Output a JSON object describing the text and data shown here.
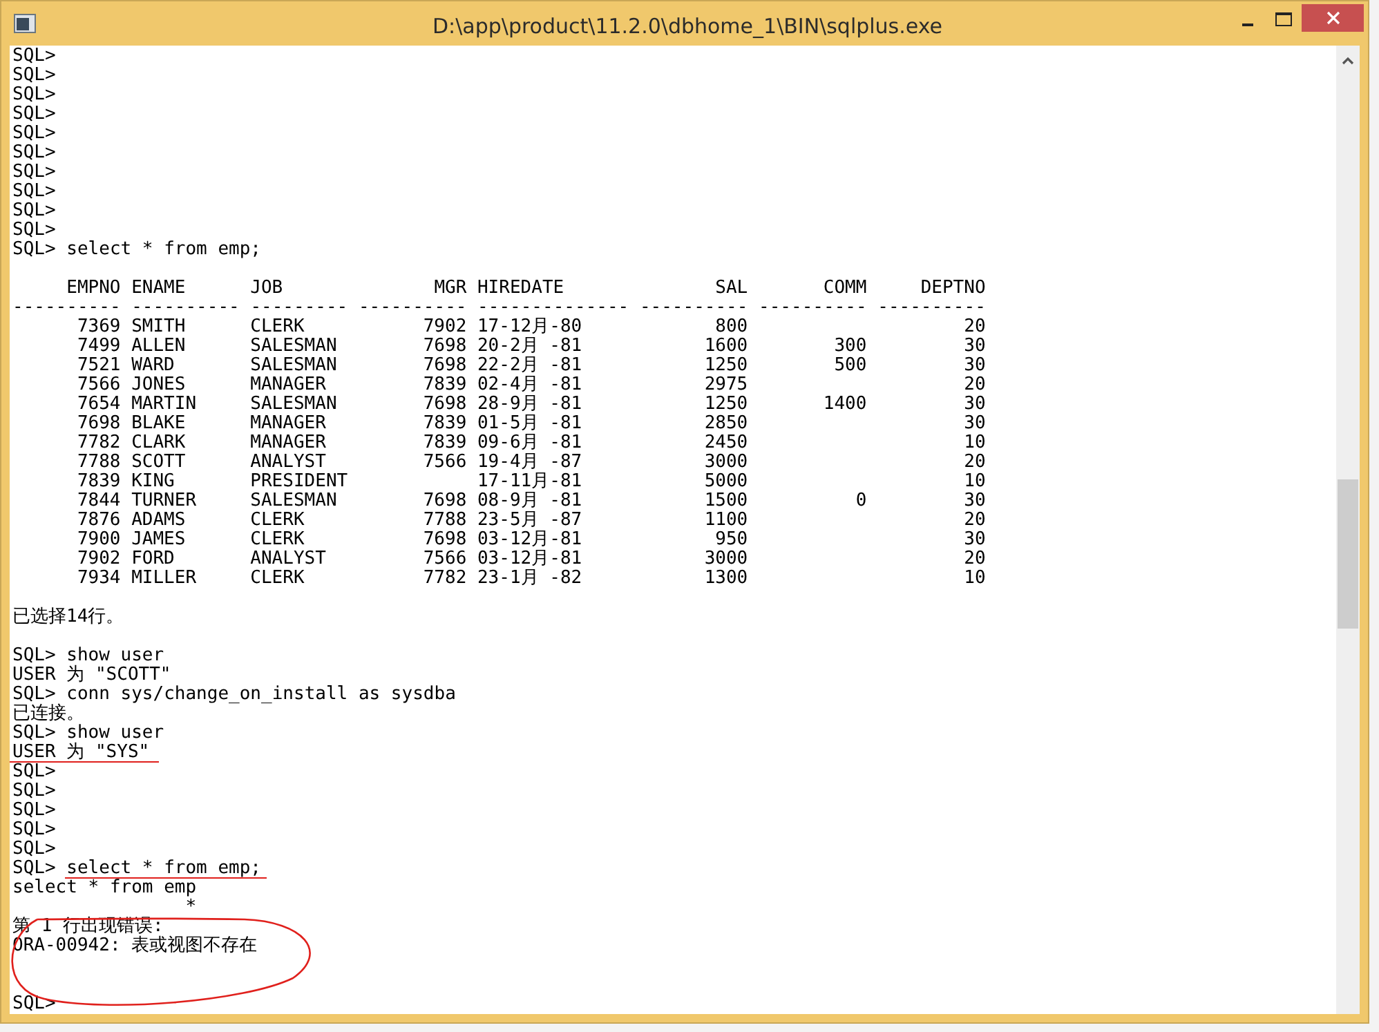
{
  "window": {
    "title": "D:\\app\\product\\11.2.0\\dbhome_1\\BIN\\sqlplus.exe"
  },
  "console": [
    {
      "kind": "line",
      "text": "SQL>"
    },
    {
      "kind": "line",
      "text": "SQL>"
    },
    {
      "kind": "line",
      "text": "SQL>"
    },
    {
      "kind": "line",
      "text": "SQL>"
    },
    {
      "kind": "line",
      "text": "SQL>"
    },
    {
      "kind": "line",
      "text": "SQL>"
    },
    {
      "kind": "line",
      "text": "SQL>"
    },
    {
      "kind": "line",
      "text": "SQL>"
    },
    {
      "kind": "line",
      "text": "SQL>"
    },
    {
      "kind": "line",
      "text": "SQL>"
    },
    {
      "kind": "line",
      "text": "SQL> select * from emp;"
    },
    {
      "kind": "blank"
    },
    {
      "kind": "table",
      "columns": [
        {
          "label": "EMPNO",
          "rule": "----------",
          "numeric": true
        },
        {
          "label": "ENAME",
          "rule": "----------",
          "numeric": false
        },
        {
          "label": "JOB",
          "rule": "---------",
          "numeric": false
        },
        {
          "label": "MGR",
          "rule": "----------",
          "numeric": true
        },
        {
          "label": "HIREDATE",
          "rule": "--------------",
          "numeric": false
        },
        {
          "label": "SAL",
          "rule": "----------",
          "numeric": true
        },
        {
          "label": "COMM",
          "rule": "----------",
          "numeric": true
        },
        {
          "label": "DEPTNO",
          "rule": "----------",
          "numeric": true
        }
      ],
      "rows": [
        [
          "7369",
          "SMITH",
          "CLERK",
          "7902",
          "17-12月-80",
          "800",
          "",
          "20"
        ],
        [
          "7499",
          "ALLEN",
          "SALESMAN",
          "7698",
          "20-2月 -81",
          "1600",
          "300",
          "30"
        ],
        [
          "7521",
          "WARD",
          "SALESMAN",
          "7698",
          "22-2月 -81",
          "1250",
          "500",
          "30"
        ],
        [
          "7566",
          "JONES",
          "MANAGER",
          "7839",
          "02-4月 -81",
          "2975",
          "",
          "20"
        ],
        [
          "7654",
          "MARTIN",
          "SALESMAN",
          "7698",
          "28-9月 -81",
          "1250",
          "1400",
          "30"
        ],
        [
          "7698",
          "BLAKE",
          "MANAGER",
          "7839",
          "01-5月 -81",
          "2850",
          "",
          "30"
        ],
        [
          "7782",
          "CLARK",
          "MANAGER",
          "7839",
          "09-6月 -81",
          "2450",
          "",
          "10"
        ],
        [
          "7788",
          "SCOTT",
          "ANALYST",
          "7566",
          "19-4月 -87",
          "3000",
          "",
          "20"
        ],
        [
          "7839",
          "KING",
          "PRESIDENT",
          "",
          "17-11月-81",
          "5000",
          "",
          "10"
        ],
        [
          "7844",
          "TURNER",
          "SALESMAN",
          "7698",
          "08-9月 -81",
          "1500",
          "0",
          "30"
        ],
        [
          "7876",
          "ADAMS",
          "CLERK",
          "7788",
          "23-5月 -87",
          "1100",
          "",
          "20"
        ],
        [
          "7900",
          "JAMES",
          "CLERK",
          "7698",
          "03-12月-81",
          "950",
          "",
          "30"
        ],
        [
          "7902",
          "FORD",
          "ANALYST",
          "7566",
          "03-12月-81",
          "3000",
          "",
          "20"
        ],
        [
          "7934",
          "MILLER",
          "CLERK",
          "7782",
          "23-1月 -82",
          "1300",
          "",
          "10"
        ]
      ]
    },
    {
      "kind": "blank"
    },
    {
      "kind": "line",
      "text": "已选择14行。"
    },
    {
      "kind": "blank"
    },
    {
      "kind": "line",
      "text": "SQL> show user"
    },
    {
      "kind": "line",
      "text": "USER 为 \"SCOTT\""
    },
    {
      "kind": "line",
      "text": "SQL> conn sys/change_on_install as sysdba"
    },
    {
      "kind": "line",
      "text": "已连接。"
    },
    {
      "kind": "line",
      "text": "SQL> show user"
    },
    {
      "kind": "line",
      "text": "USER 为 \"SYS\""
    },
    {
      "kind": "line",
      "text": "SQL>"
    },
    {
      "kind": "line",
      "text": "SQL>"
    },
    {
      "kind": "line",
      "text": "SQL>"
    },
    {
      "kind": "line",
      "text": "SQL>"
    },
    {
      "kind": "line",
      "text": "SQL>"
    },
    {
      "kind": "line",
      "text": "SQL> select * from emp;"
    },
    {
      "kind": "line",
      "text": "select * from emp"
    },
    {
      "kind": "line",
      "text": "                *"
    },
    {
      "kind": "line",
      "text": "第 1 行出现错误:"
    },
    {
      "kind": "line",
      "text": "ORA-00942: 表或视图不存在"
    },
    {
      "kind": "blank"
    },
    {
      "kind": "blank"
    },
    {
      "kind": "line",
      "text": "SQL>"
    }
  ]
}
